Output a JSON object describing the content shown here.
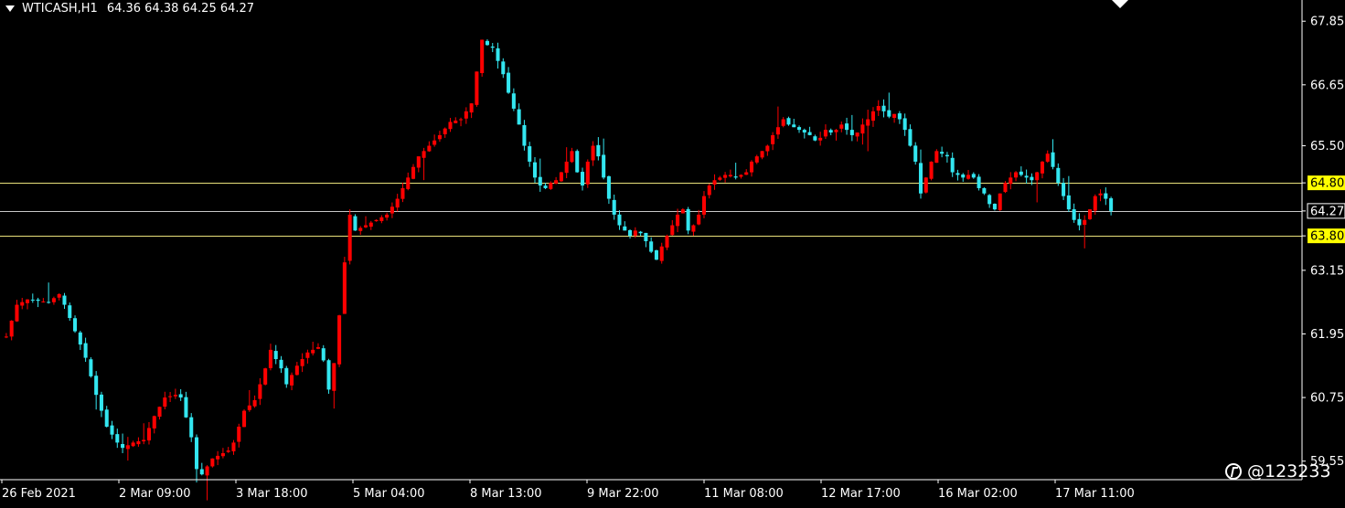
{
  "header": {
    "symbol": "WTICASH,H1",
    "ohlc": "64.36 64.38 64.25 64.27"
  },
  "watermark": "@123233",
  "colors": {
    "background": "#000000",
    "bull": "#ff0000",
    "bear": "#33e6f0",
    "level_line": "#e8e07a",
    "price_line": "#c8c8c8",
    "axis": "#ffffff",
    "level_label_bg": "#ffff00"
  },
  "chart_data": {
    "type": "candlestick",
    "ylim": [
      59.2,
      68.25
    ],
    "y_ticks": [
      "67.85",
      "66.65",
      "65.50",
      "64.80",
      "64.27",
      "63.80",
      "63.15",
      "61.95",
      "60.75",
      "59.55"
    ],
    "x_ticks": [
      "26 Feb 2021",
      "2 Mar 09:00",
      "3 Mar 18:00",
      "5 Mar 04:00",
      "8 Mar 13:00",
      "9 Mar 22:00",
      "11 Mar 08:00",
      "12 Mar 17:00",
      "16 Mar 02:00",
      "17 Mar 11:00"
    ],
    "horizontal_levels": [
      {
        "price": 64.8,
        "label": "64.80",
        "style": "yellow"
      },
      {
        "price": 64.27,
        "label": "64.27",
        "style": "current"
      },
      {
        "price": 63.8,
        "label": "63.80",
        "style": "yellow"
      }
    ],
    "close_path": [
      [
        0,
        61.9
      ],
      [
        2,
        62.5
      ],
      [
        4,
        62.6
      ],
      [
        8,
        62.55
      ],
      [
        10,
        62.7
      ],
      [
        11,
        62.5
      ],
      [
        13,
        62.0
      ],
      [
        15,
        61.5
      ],
      [
        17,
        60.8
      ],
      [
        19,
        60.2
      ],
      [
        21,
        59.9
      ],
      [
        22,
        59.8
      ],
      [
        24,
        59.9
      ],
      [
        26,
        59.95
      ],
      [
        28,
        60.4
      ],
      [
        30,
        60.75
      ],
      [
        32,
        60.8
      ],
      [
        33,
        60.75
      ],
      [
        35,
        60.0
      ],
      [
        36,
        59.4
      ],
      [
        37,
        59.3
      ],
      [
        39,
        59.6
      ],
      [
        41,
        59.7
      ],
      [
        42,
        59.75
      ],
      [
        43,
        59.9
      ],
      [
        45,
        60.5
      ],
      [
        47,
        60.7
      ],
      [
        49,
        61.3
      ],
      [
        50,
        61.65
      ],
      [
        52,
        61.3
      ],
      [
        53,
        61.0
      ],
      [
        55,
        61.35
      ],
      [
        57,
        61.6
      ],
      [
        59,
        61.7
      ],
      [
        60,
        61.45
      ],
      [
        61,
        60.9
      ],
      [
        62,
        61.4
      ],
      [
        63,
        62.3
      ],
      [
        64,
        63.3
      ],
      [
        65,
        64.2
      ],
      [
        66,
        63.9
      ],
      [
        68,
        64.0
      ],
      [
        70,
        64.1
      ],
      [
        72,
        64.2
      ],
      [
        74,
        64.5
      ],
      [
        76,
        64.9
      ],
      [
        78,
        65.3
      ],
      [
        80,
        65.5
      ],
      [
        82,
        65.7
      ],
      [
        84,
        65.95
      ],
      [
        86,
        66.0
      ],
      [
        88,
        66.3
      ],
      [
        89,
        66.9
      ],
      [
        90,
        67.5
      ],
      [
        91,
        67.4
      ],
      [
        92,
        67.35
      ],
      [
        93,
        67.1
      ],
      [
        94,
        66.85
      ],
      [
        95,
        66.5
      ],
      [
        96,
        66.2
      ],
      [
        97,
        65.9
      ],
      [
        98,
        65.5
      ],
      [
        99,
        65.2
      ],
      [
        100,
        64.9
      ],
      [
        101,
        64.75
      ],
      [
        102,
        64.7
      ],
      [
        103,
        64.8
      ],
      [
        104,
        64.85
      ],
      [
        105,
        65.0
      ],
      [
        107,
        65.4
      ],
      [
        108,
        65.0
      ],
      [
        109,
        64.75
      ],
      [
        110,
        65.2
      ],
      [
        111,
        65.5
      ],
      [
        112,
        65.3
      ],
      [
        113,
        64.9
      ],
      [
        114,
        64.5
      ],
      [
        115,
        64.2
      ],
      [
        116,
        64.0
      ],
      [
        117,
        63.9
      ],
      [
        118,
        63.8
      ],
      [
        119,
        63.9
      ],
      [
        120,
        63.85
      ],
      [
        121,
        63.7
      ],
      [
        122,
        63.5
      ],
      [
        123,
        63.35
      ],
      [
        124,
        63.6
      ],
      [
        125,
        63.8
      ],
      [
        126,
        64.0
      ],
      [
        127,
        64.2
      ],
      [
        128,
        64.3
      ],
      [
        129,
        63.9
      ],
      [
        130,
        64.0
      ],
      [
        131,
        64.2
      ],
      [
        132,
        64.55
      ],
      [
        133,
        64.75
      ],
      [
        134,
        64.85
      ],
      [
        135,
        64.9
      ],
      [
        136,
        64.95
      ],
      [
        137,
        64.95
      ],
      [
        138,
        64.9
      ],
      [
        139,
        64.95
      ],
      [
        140,
        65.0
      ],
      [
        141,
        65.2
      ],
      [
        142,
        65.3
      ],
      [
        143,
        65.4
      ],
      [
        144,
        65.5
      ],
      [
        145,
        65.7
      ],
      [
        146,
        65.85
      ],
      [
        147,
        66.0
      ],
      [
        148,
        65.9
      ],
      [
        149,
        65.85
      ],
      [
        150,
        65.8
      ],
      [
        151,
        65.75
      ],
      [
        152,
        65.7
      ],
      [
        153,
        65.6
      ],
      [
        154,
        65.65
      ],
      [
        155,
        65.8
      ],
      [
        156,
        65.75
      ],
      [
        157,
        65.8
      ],
      [
        158,
        65.9
      ],
      [
        159,
        65.8
      ],
      [
        160,
        65.7
      ],
      [
        161,
        65.75
      ],
      [
        162,
        65.9
      ],
      [
        163,
        66.0
      ],
      [
        164,
        66.15
      ],
      [
        165,
        66.25
      ],
      [
        166,
        66.15
      ],
      [
        167,
        66.05
      ],
      [
        168,
        66.1
      ],
      [
        169,
        66.0
      ],
      [
        170,
        65.8
      ],
      [
        171,
        65.5
      ],
      [
        172,
        65.2
      ],
      [
        173,
        64.6
      ],
      [
        174,
        64.9
      ],
      [
        175,
        65.2
      ],
      [
        176,
        65.4
      ],
      [
        177,
        65.35
      ],
      [
        178,
        65.3
      ],
      [
        179,
        65.0
      ],
      [
        180,
        64.95
      ],
      [
        181,
        64.9
      ],
      [
        182,
        64.95
      ],
      [
        183,
        64.9
      ],
      [
        184,
        64.7
      ],
      [
        185,
        64.6
      ],
      [
        186,
        64.4
      ],
      [
        187,
        64.3
      ],
      [
        188,
        64.6
      ],
      [
        189,
        64.8
      ],
      [
        190,
        64.9
      ],
      [
        191,
        65.0
      ],
      [
        192,
        64.95
      ],
      [
        193,
        64.9
      ],
      [
        194,
        64.85
      ],
      [
        195,
        65.0
      ],
      [
        196,
        65.2
      ],
      [
        197,
        65.35
      ],
      [
        198,
        65.1
      ],
      [
        199,
        64.8
      ],
      [
        200,
        64.55
      ],
      [
        201,
        64.3
      ],
      [
        202,
        64.1
      ],
      [
        203,
        64.0
      ],
      [
        204,
        64.1
      ],
      [
        205,
        64.3
      ],
      [
        206,
        64.55
      ],
      [
        207,
        64.6
      ],
      [
        208,
        64.5
      ],
      [
        209,
        64.27
      ]
    ]
  }
}
